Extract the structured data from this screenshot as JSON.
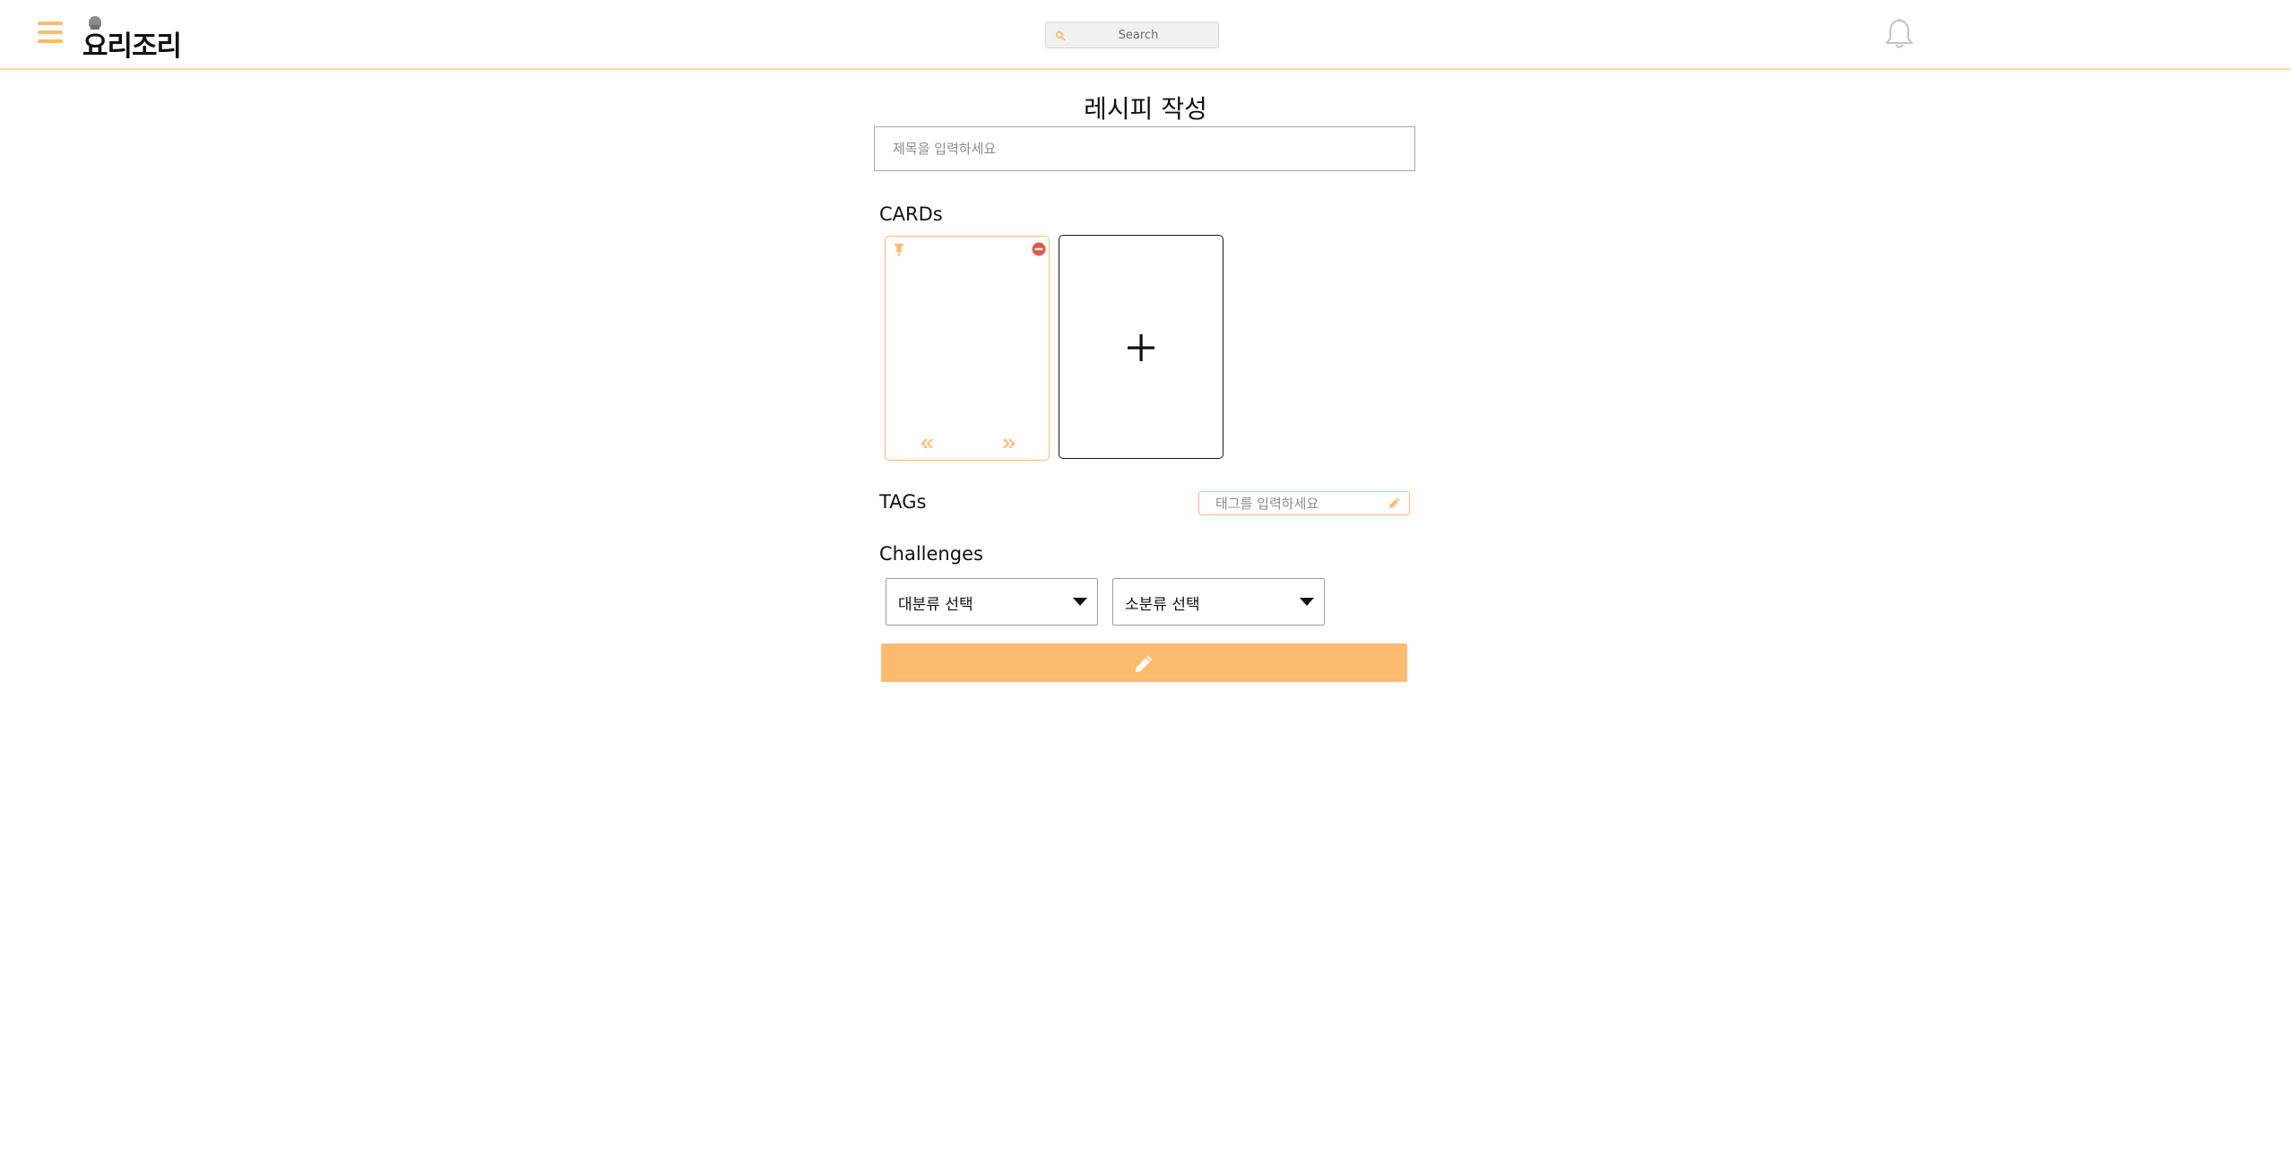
{
  "header": {
    "logo_text": "요리조리",
    "search": {
      "placeholder": "Search"
    }
  },
  "page": {
    "title": "레시피 작성",
    "title_input": {
      "placeholder": "제목을 입력하세요",
      "value": ""
    }
  },
  "cards_section": {
    "label": "CARDs",
    "add_label": "+"
  },
  "tags_section": {
    "label": "TAGs",
    "input": {
      "placeholder": "태그를 입력하세요",
      "value": ""
    }
  },
  "challenges_section": {
    "label": "Challenges",
    "major_select": "대분류 선택",
    "minor_select": "소분류 선택"
  },
  "colors": {
    "accent": "#fdbb70",
    "header_border": "#fcd9ad",
    "remove": "#e5564a",
    "bell": "#c4c4c4"
  },
  "icons": [
    "menu-icon",
    "search-icon",
    "bell-icon",
    "pin-icon",
    "remove-icon",
    "chevron-double-left-icon",
    "chevron-double-right-icon",
    "plus-icon",
    "pencil-icon",
    "caret-down-icon"
  ]
}
